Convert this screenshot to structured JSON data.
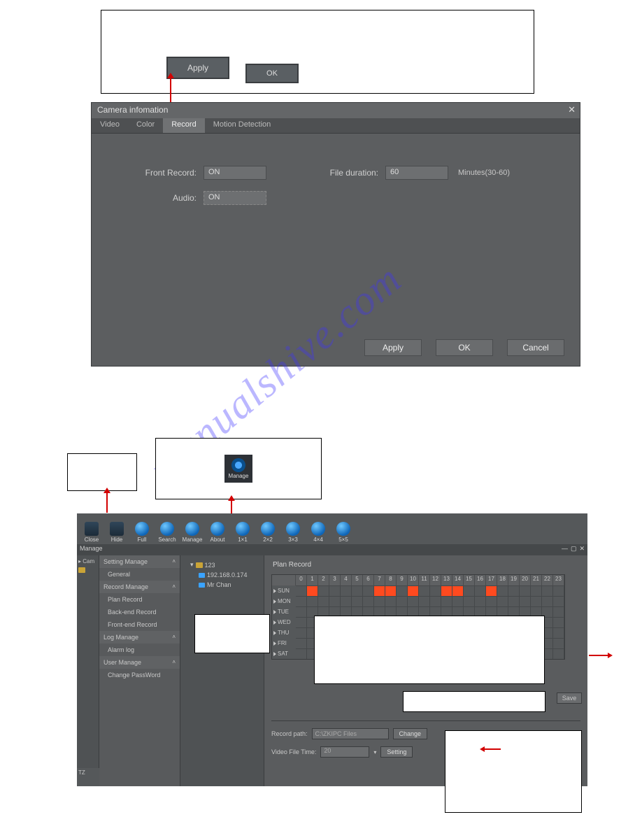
{
  "top_buttons": {
    "apply": "Apply",
    "ok": "OK"
  },
  "camera_dialog": {
    "title": "Camera infomation",
    "tabs": [
      "Video",
      "Color",
      "Record",
      "Motion Detection"
    ],
    "active_tab": "Record",
    "front_record_label": "Front Record:",
    "front_record_value": "ON",
    "file_duration_label": "File duration:",
    "file_duration_value": "60",
    "file_duration_note": "Minutes(30-60)",
    "audio_label": "Audio:",
    "audio_value": "ON",
    "buttons": {
      "apply": "Apply",
      "ok": "OK",
      "cancel": "Cancel"
    }
  },
  "watermark_text": "manualshive.com",
  "manage_icon_label": "Manage",
  "toolbar": [
    {
      "label": "Close"
    },
    {
      "label": "Hide"
    },
    {
      "label": "Full"
    },
    {
      "label": "Search"
    },
    {
      "label": "Manage"
    },
    {
      "label": "About"
    },
    {
      "label": "1×1"
    },
    {
      "label": "2×2"
    },
    {
      "label": "3×3"
    },
    {
      "label": "4×4"
    },
    {
      "label": "5×5"
    }
  ],
  "mgr_title": "Manage",
  "farleft": [
    "Cam"
  ],
  "side": {
    "setting_manage": "Setting Manage",
    "general": "General",
    "record_manage": "Record Manage",
    "plan_record": "Plan Record",
    "backend_record": "Back-end Record",
    "frontend_record": "Front-end Record",
    "log_manage": "Log Manage",
    "alarm_log": "Alarm log",
    "user_manage": "User Manage",
    "change_password": "Change PassWord"
  },
  "tree": {
    "root": "123",
    "children": [
      "192.168.0.174",
      "Mr Chan"
    ]
  },
  "plan": {
    "title": "Plan Record",
    "hours": [
      "0",
      "1",
      "2",
      "3",
      "4",
      "5",
      "6",
      "7",
      "8",
      "9",
      "10",
      "11",
      "12",
      "13",
      "14",
      "15",
      "16",
      "17",
      "18",
      "19",
      "20",
      "21",
      "22",
      "23"
    ],
    "days": [
      "SUN",
      "MON",
      "TUE",
      "WED",
      "THU",
      "FRI",
      "SAT"
    ],
    "sun_on": [
      1,
      7,
      8,
      10,
      13,
      14,
      17
    ],
    "save": "Save"
  },
  "lower": {
    "record_path_label": "Record path:",
    "record_path_value": "C:\\ZKIPC Files",
    "change": "Change",
    "video_file_time_label": "Video File Time:",
    "video_file_time_value": "20",
    "setting": "Setting"
  },
  "tz_label": "TZ"
}
